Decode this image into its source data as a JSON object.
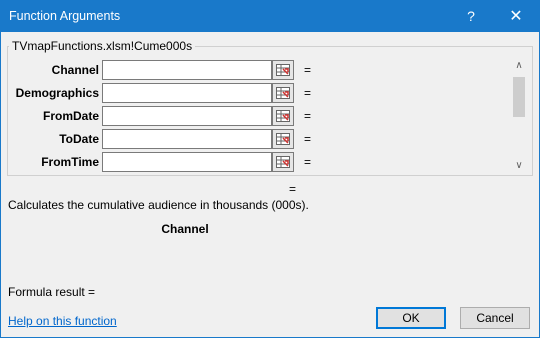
{
  "window": {
    "title": "Function Arguments",
    "help_glyph": "?",
    "close_glyph": "✕"
  },
  "function_group": {
    "label": "TVmapFunctions.xlsm!Cume000s",
    "arguments": [
      {
        "label": "Channel",
        "value": "",
        "equals": "="
      },
      {
        "label": "Demographics",
        "value": "",
        "equals": "="
      },
      {
        "label": "FromDate",
        "value": "",
        "equals": "="
      },
      {
        "label": "ToDate",
        "value": "",
        "equals": "="
      },
      {
        "label": "FromTime",
        "value": "",
        "equals": "="
      }
    ]
  },
  "result_equals": "=",
  "description": "Calculates the cumulative audience in thousands (000s).",
  "arg_description_name": "Channel",
  "formula_result": "Formula result =",
  "help_link": "Help on this function",
  "buttons": {
    "ok": "OK",
    "cancel": "Cancel"
  },
  "icons": {
    "ref": "range-select-icon"
  },
  "colors": {
    "titlebar": "#1979ca",
    "link": "#0066cc",
    "ok_border": "#0078d7"
  }
}
